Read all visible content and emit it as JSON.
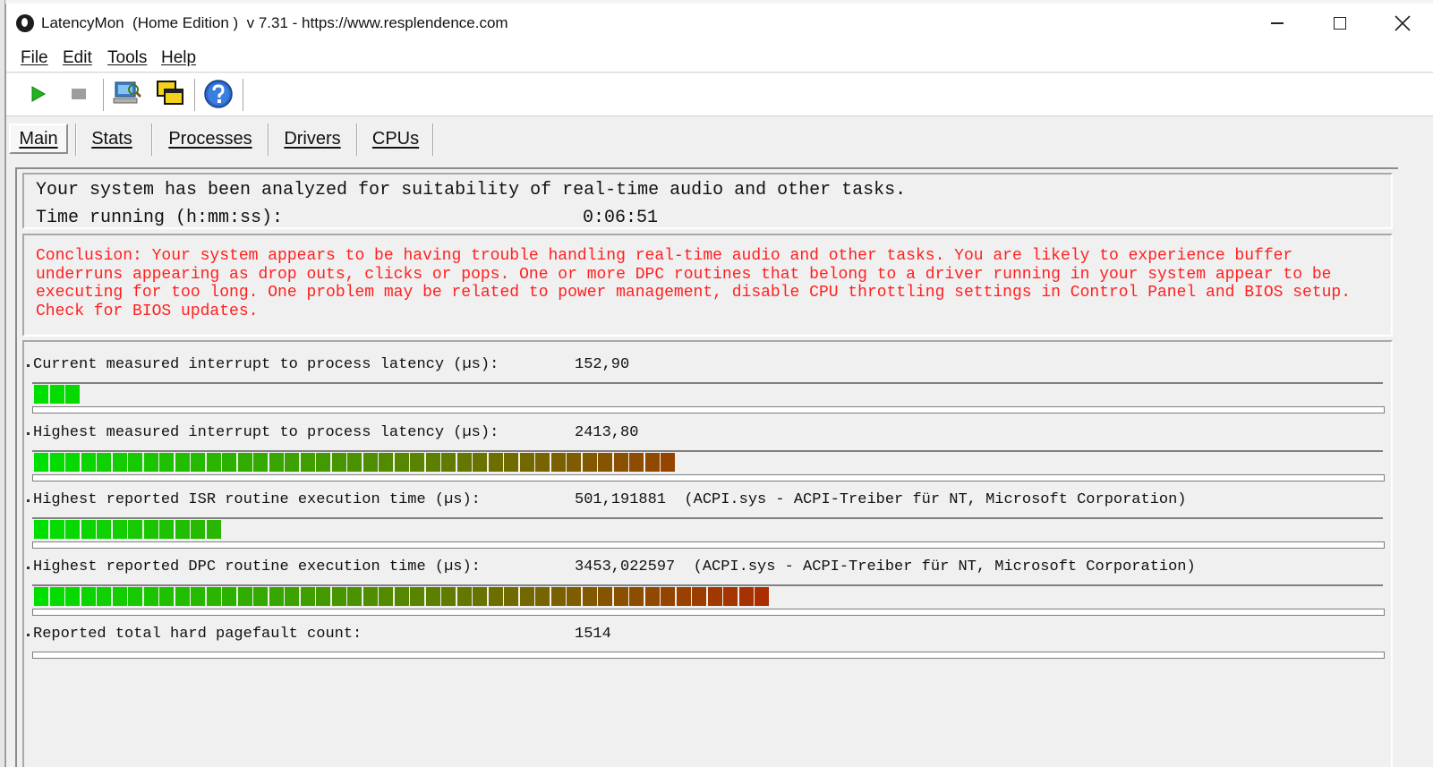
{
  "window": {
    "title": "LatencyMon  (Home Edition )  v 7.31 - https://www.resplendence.com",
    "icons": {
      "minimize": "minimize-icon",
      "maximize": "maximize-icon",
      "close": "close-icon"
    }
  },
  "menu": {
    "file": "File",
    "edit": "Edit",
    "tools": "Tools",
    "help": "Help"
  },
  "toolbar": {
    "icons": [
      "play-icon",
      "stop-icon",
      "computer-search-icon",
      "windows-icon",
      "help-icon"
    ]
  },
  "tabs": {
    "main": "Main",
    "stats": "Stats",
    "processes": "Processes",
    "drivers": "Drivers",
    "cpus": "CPUs",
    "active": "Main"
  },
  "summary": {
    "analysis": "Your system has been analyzed for suitability of real-time audio and other tasks.",
    "time_label": "Time running (h:mm:ss):",
    "time_value": "0:06:51"
  },
  "conclusion": "Conclusion: Your system appears to be having trouble handling real-time audio and other tasks. You are likely to experience buffer underruns appearing as drop outs, clicks or pops. One or more DPC routines that belong to a driver running in your system appear to be executing for too long. One problem may be related to power management, disable CPU throttling settings in Control Panel and BIOS setup. Check for BIOS updates.",
  "colors": {
    "conclusion_text": "#ff2020",
    "bar_low": "#00e000",
    "bar_high": "#b02800"
  },
  "metrics": [
    {
      "label": "Current measured interrupt to process latency (µs):",
      "value": "152,90",
      "segments": 3,
      "of": 86
    },
    {
      "label": "Highest measured interrupt to process latency (µs):",
      "value": "2413,80",
      "segments": 41,
      "of": 86
    },
    {
      "label": "Highest reported ISR routine execution time (µs):",
      "value": "501,191881  (ACPI.sys - ACPI-Treiber für NT, Microsoft Corporation)",
      "segments": 12,
      "of": 86
    },
    {
      "label": "Highest reported DPC routine execution time (µs):",
      "value": "3453,022597  (ACPI.sys - ACPI-Treiber für NT, Microsoft Corporation)",
      "segments": 47,
      "of": 86
    },
    {
      "label": "Reported total hard pagefault count:",
      "value": "1514",
      "segments": 0,
      "of": 86
    }
  ]
}
